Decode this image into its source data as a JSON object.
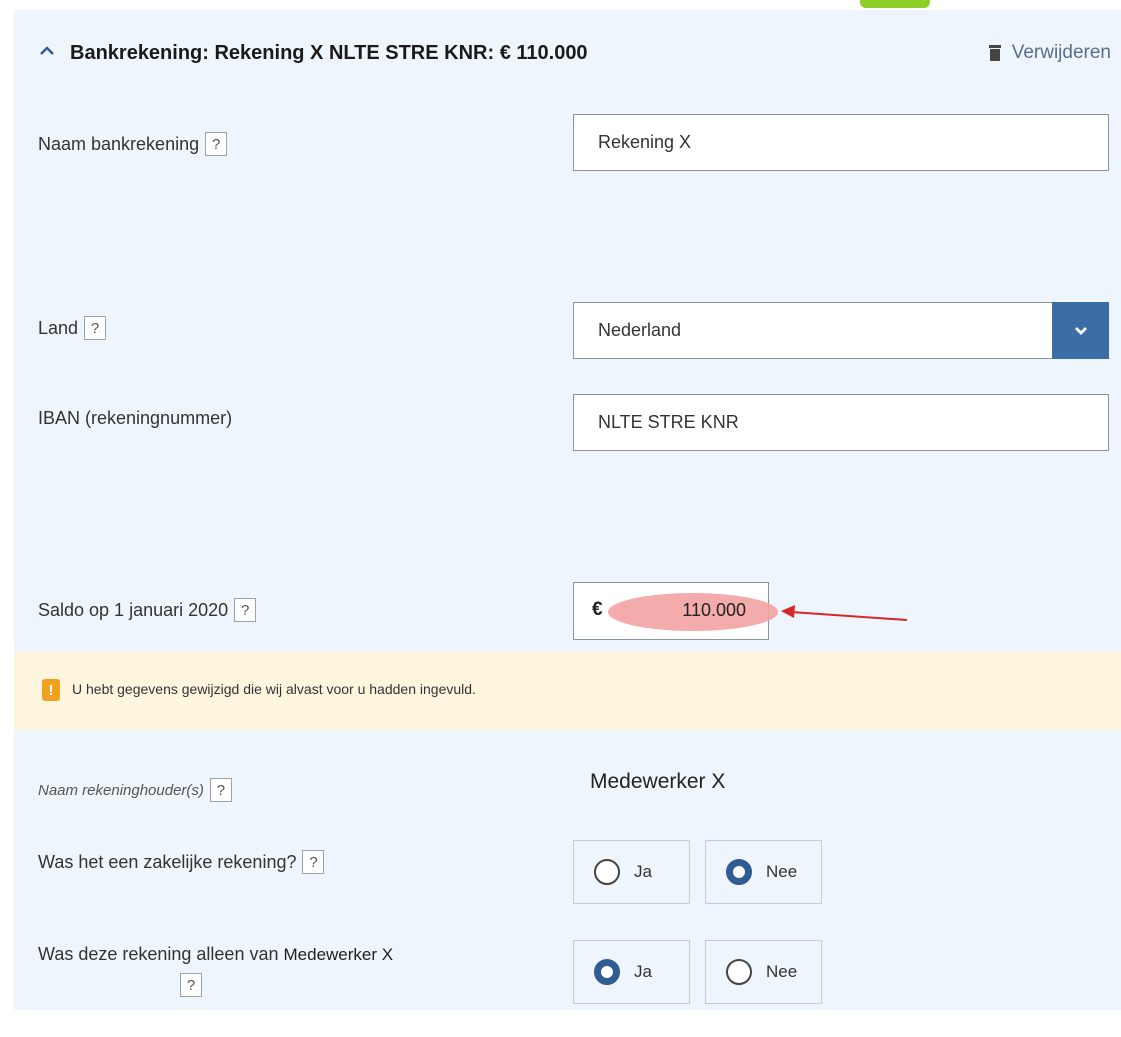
{
  "header": {
    "title": "Bankrekening: Rekening X NLTE STRE KNR: € 110.000",
    "delete_label": "Verwijderen",
    "collapse_icon": "chevron-up-icon",
    "delete_icon": "trash-icon"
  },
  "fields": {
    "account_name": {
      "label": "Naam bankrekening",
      "value": "Rekening X",
      "help": "?"
    },
    "country": {
      "label": "Land",
      "value": "Nederland",
      "help": "?"
    },
    "iban": {
      "label": "IBAN (rekeningnummer)",
      "value": "NLTE STRE KNR"
    },
    "balance": {
      "label": "Saldo op 1 januari 2020",
      "currency": "€",
      "value": "110.000",
      "help": "?"
    }
  },
  "warning": {
    "text": "U hebt gegevens gewijzigd die wij alvast voor u hadden ingevuld.",
    "icon": "!"
  },
  "holder": {
    "label": "Naam rekeninghouder(s)",
    "value": "Medewerker X",
    "help": "?"
  },
  "business_account": {
    "label": "Was het een zakelijke rekening?",
    "help": "?",
    "options": [
      "Ja",
      "Nee"
    ],
    "selected": "Nee"
  },
  "sole_owner": {
    "label_prefix": "Was deze rekening alleen van",
    "name": "Medewerker X",
    "help": "?",
    "options": [
      "Ja",
      "Nee"
    ],
    "selected": "Ja"
  },
  "colors": {
    "panel_bg": "#eef5fc",
    "primary": "#3a6ea5",
    "warning_bg": "#fdf5de",
    "highlight": "#f2a2a2",
    "arrow": "#d62828"
  }
}
